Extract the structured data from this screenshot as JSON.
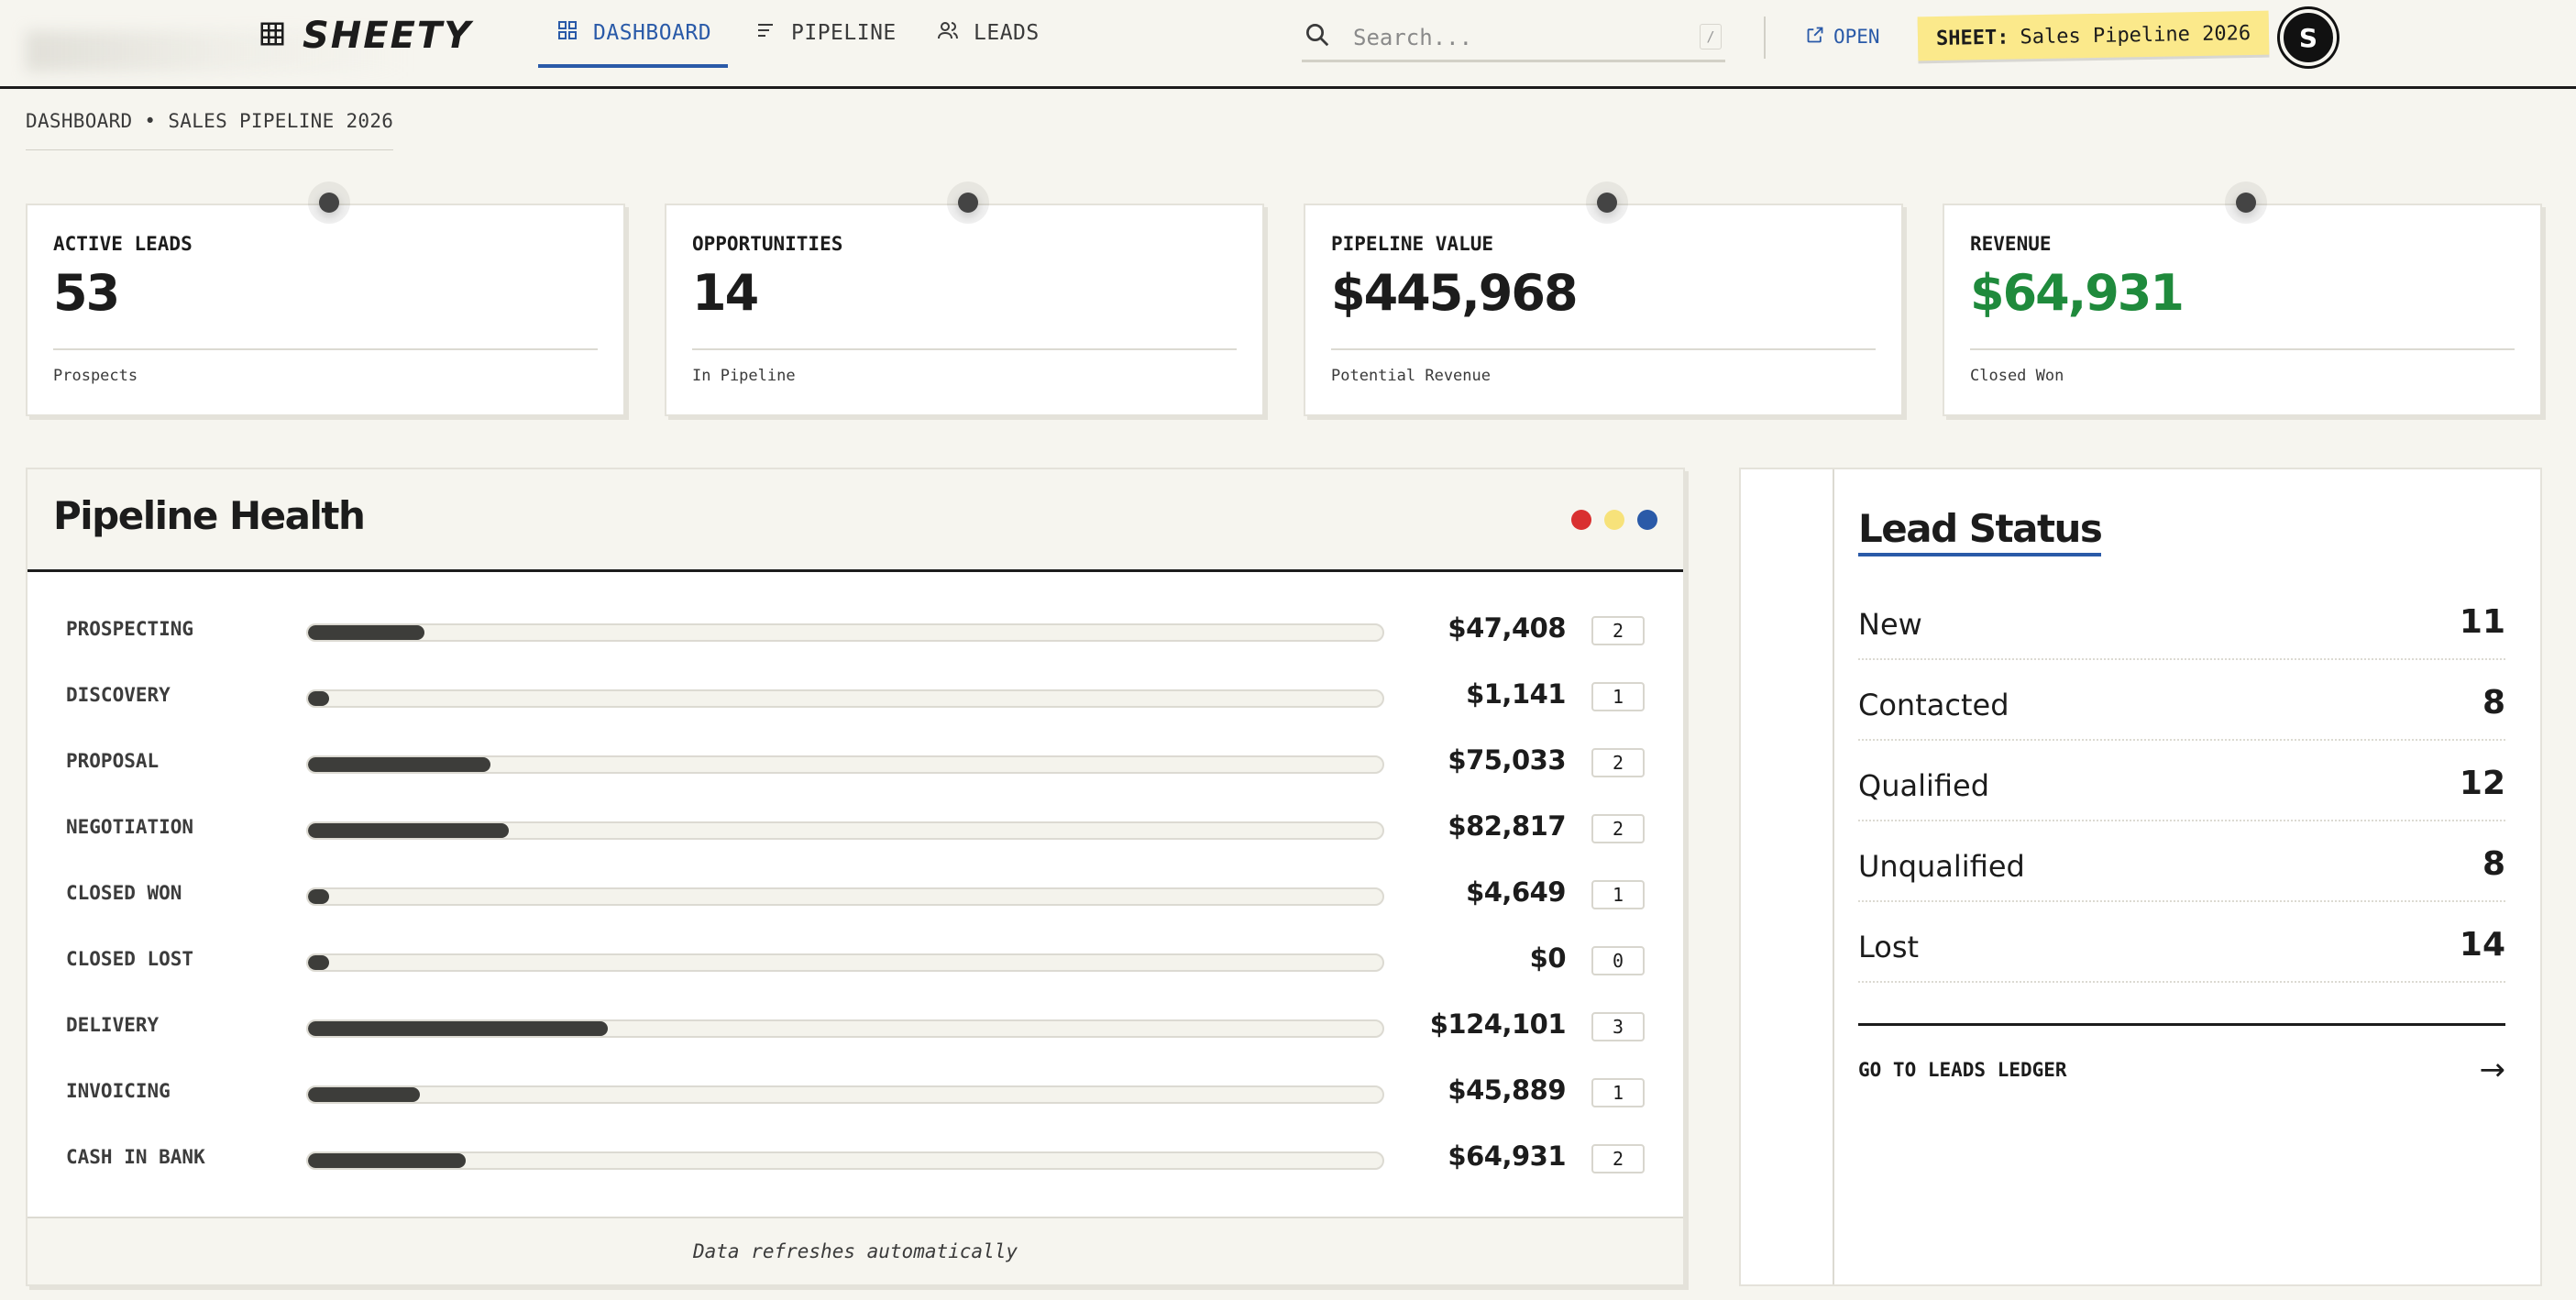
{
  "app": {
    "name": "SHEETY"
  },
  "nav": {
    "dashboard": "DASHBOARD",
    "pipeline": "PIPELINE",
    "leads": "LEADS"
  },
  "search": {
    "placeholder": "Search...",
    "shortcut": "/"
  },
  "open_label": "OPEN",
  "sheet_badge": {
    "prefix": "SHEET:",
    "name": "Sales Pipeline 2026"
  },
  "avatar_initial": "S",
  "breadcrumb": "DASHBOARD • SALES PIPELINE 2026",
  "kpis": [
    {
      "label": "ACTIVE LEADS",
      "value": "53",
      "sub": "Prospects"
    },
    {
      "label": "OPPORTUNITIES",
      "value": "14",
      "sub": "In Pipeline"
    },
    {
      "label": "PIPELINE VALUE",
      "value": "$445,968",
      "sub": "Potential Revenue"
    },
    {
      "label": "REVENUE",
      "value": "$64,931",
      "sub": "Closed Won"
    }
  ],
  "pipeline_health": {
    "title": "Pipeline Health",
    "footer": "Data refreshes automatically",
    "stages": [
      {
        "label": "PROSPECTING",
        "value": "$47,408",
        "count": "2",
        "fill": 0.108
      },
      {
        "label": "DISCOVERY",
        "value": "$1,141",
        "count": "1",
        "fill": 0.02
      },
      {
        "label": "PROPOSAL",
        "value": "$75,033",
        "count": "2",
        "fill": 0.17
      },
      {
        "label": "NEGOTIATION",
        "value": "$82,817",
        "count": "2",
        "fill": 0.187
      },
      {
        "label": "CLOSED WON",
        "value": "$4,649",
        "count": "1",
        "fill": 0.02
      },
      {
        "label": "CLOSED LOST",
        "value": "$0",
        "count": "0",
        "fill": 0.02
      },
      {
        "label": "DELIVERY",
        "value": "$124,101",
        "count": "3",
        "fill": 0.279
      },
      {
        "label": "INVOICING",
        "value": "$45,889",
        "count": "1",
        "fill": 0.104
      },
      {
        "label": "CASH IN BANK",
        "value": "$64,931",
        "count": "2",
        "fill": 0.147
      }
    ]
  },
  "lead_status": {
    "title": "Lead Status",
    "rows": [
      {
        "name": "New",
        "count": "11"
      },
      {
        "name": "Contacted",
        "count": "8"
      },
      {
        "name": "Qualified",
        "count": "12"
      },
      {
        "name": "Unqualified",
        "count": "8"
      },
      {
        "name": "Lost",
        "count": "14"
      }
    ],
    "link_label": "GO TO LEADS LEDGER",
    "link_arrow": "→"
  },
  "colors": {
    "accent_blue": "#2a5aa8",
    "revenue_green": "#1f8a3c",
    "badge_yellow": "#fbe98b",
    "dot_red": "#d93030",
    "dot_yellow": "#f7e27a",
    "dot_blue": "#2a5aa8"
  }
}
